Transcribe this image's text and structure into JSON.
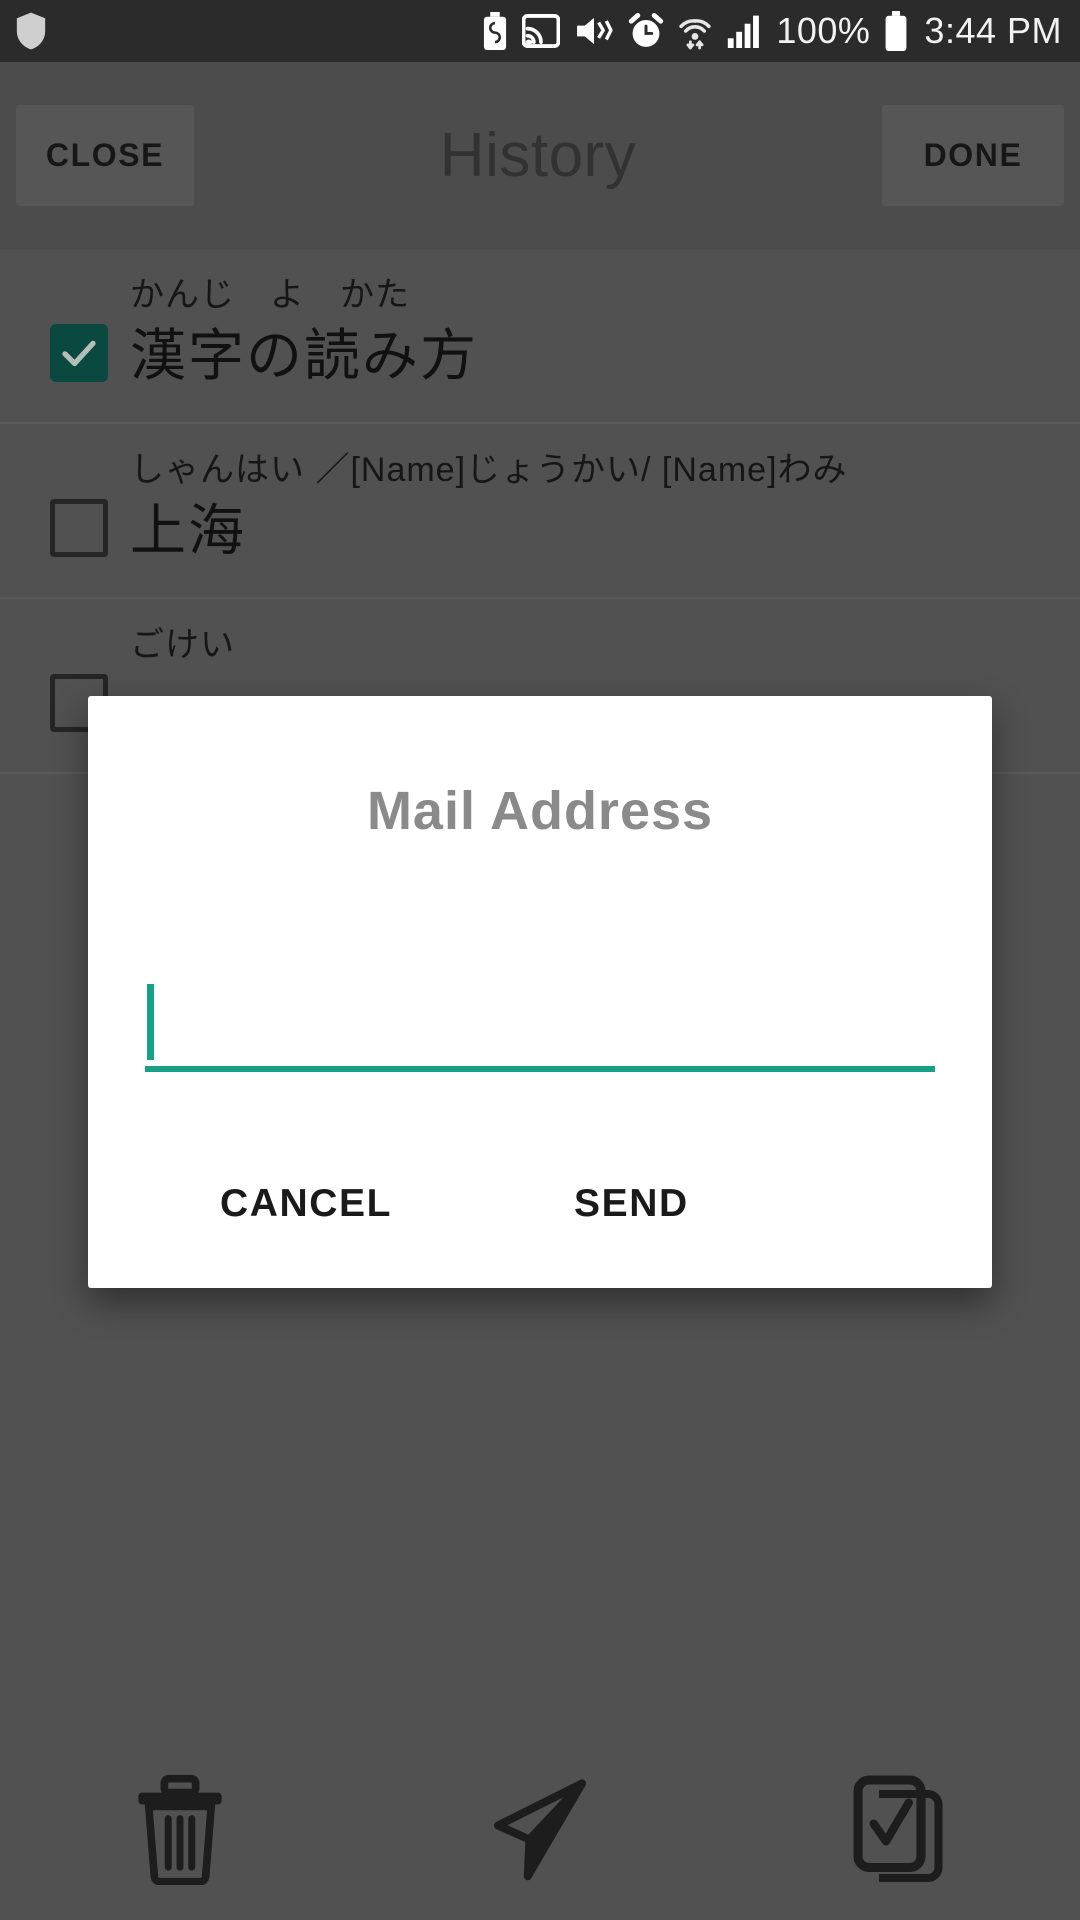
{
  "status_bar": {
    "left_icons": [
      "shield-icon"
    ],
    "right_icons": [
      "battery-saver-icon",
      "cast-icon",
      "mute-vibrate-icon",
      "alarm-icon",
      "wifi-icon",
      "signal-icon"
    ],
    "battery_percent": "100%",
    "time": "3:44 PM"
  },
  "appbar": {
    "close_label": "CLOSE",
    "title": "History",
    "done_label": "DONE"
  },
  "list": {
    "rows": [
      {
        "furigana": "かんじ　よ　かた",
        "word": "漢字の読み方",
        "checked": true
      },
      {
        "furigana": "しゃんはい ／[Name]じょうかい/ [Name]わみ",
        "word": "上海",
        "checked": false
      },
      {
        "furigana": "ごけい",
        "word": "",
        "checked": false
      }
    ]
  },
  "dialog": {
    "title": "Mail Address",
    "input_value": "",
    "input_placeholder": "",
    "cancel_label": "CANCEL",
    "send_label": "SEND"
  },
  "bottom_bar": {
    "items": [
      {
        "name": "delete-icon"
      },
      {
        "name": "send-icon"
      },
      {
        "name": "select-all-icon"
      }
    ]
  },
  "colors": {
    "accent_teal": "#16a085",
    "checkbox_checked": "#0d5a4d",
    "status_bar_bg": "#2b2b2b",
    "appbar_bg": "#5d5d5d",
    "page_bg": "#636363",
    "dialog_bg": "#ffffff"
  }
}
